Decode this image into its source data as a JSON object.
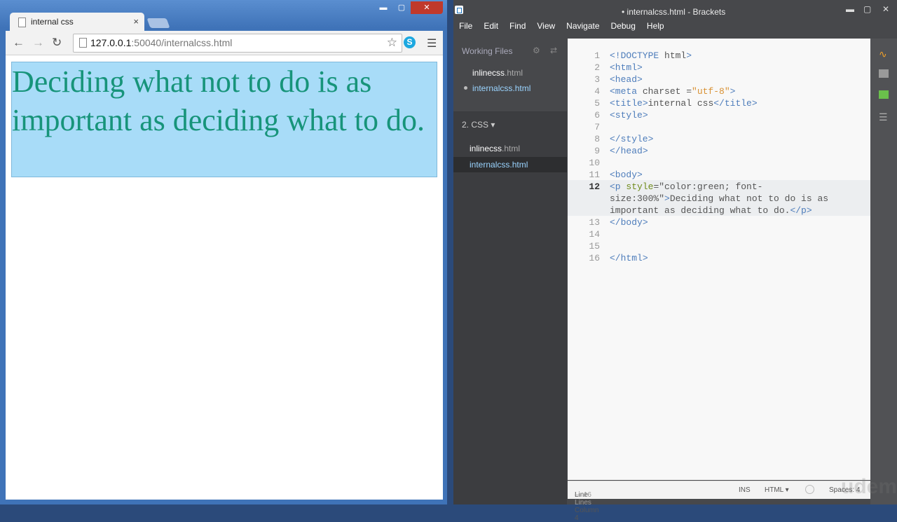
{
  "browser": {
    "tab_title": "internal css",
    "tab_close": "×",
    "url_host": "127.0.0.1",
    "url_rest": ":50040/internalcss.html",
    "paragraph": "Deciding what not to do is as important as deciding what to do.",
    "win_min": "▬",
    "win_max": "▢",
    "win_close": "✕"
  },
  "editor": {
    "window_title": "• internalcss.html - Brackets",
    "menu": [
      "File",
      "Edit",
      "Find",
      "View",
      "Navigate",
      "Debug",
      "Help"
    ],
    "working_files_label": "Working Files",
    "working_files": [
      {
        "name": "inlinecss",
        "ext": ".html"
      },
      {
        "name": "internalcss",
        "ext": ".html"
      }
    ],
    "project_label": "2. CSS ▾",
    "project_files": [
      {
        "name": "inlinecss",
        "ext": ".html"
      },
      {
        "name": "internalcss",
        "ext": ".html"
      }
    ],
    "code_lines": [
      {
        "n": "1",
        "text": "<!DOCTYPE html>"
      },
      {
        "n": "2",
        "text": "<html>"
      },
      {
        "n": "3",
        "text": "<head>"
      },
      {
        "n": "4",
        "text": "<meta charset =\"utf-8\">"
      },
      {
        "n": "5",
        "text": "<title>internal css</title>"
      },
      {
        "n": "6",
        "text": "<style>"
      },
      {
        "n": "7",
        "text": ""
      },
      {
        "n": "8",
        "text": "</style>"
      },
      {
        "n": "9",
        "text": "</head>"
      },
      {
        "n": "10",
        "text": ""
      },
      {
        "n": "11",
        "text": "<body>"
      },
      {
        "n": "12",
        "text": "<p style=\"color:green; font-"
      },
      {
        "n": "",
        "text": "size:300%\">Deciding what not to do is as"
      },
      {
        "n": "",
        "text": "important as deciding what to do.</p>"
      },
      {
        "n": "13",
        "text": "</body>"
      },
      {
        "n": "14",
        "text": ""
      },
      {
        "n": "15",
        "text": ""
      },
      {
        "n": "16",
        "text": "</html>"
      }
    ],
    "status": {
      "position": "Line 12, Column 4",
      "lines": " — 16 Lines",
      "mode": "INS",
      "language": "HTML ▾",
      "spaces": "Spaces: 4"
    }
  },
  "watermark": "udemy"
}
